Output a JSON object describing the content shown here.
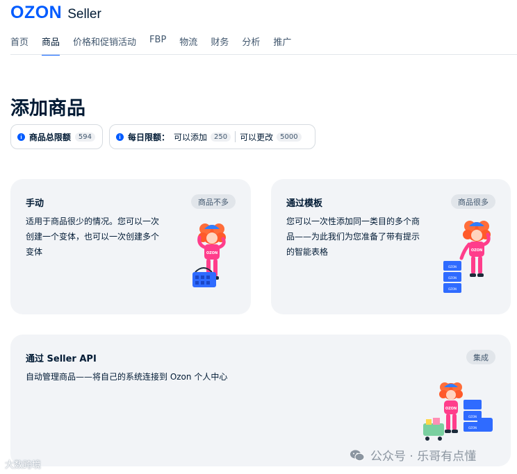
{
  "header": {
    "logo_brand": "OZON",
    "logo_product": "Seller",
    "nav": [
      {
        "label": "首页",
        "active": false
      },
      {
        "label": "商品",
        "active": true
      },
      {
        "label": "价格和促销活动",
        "active": false
      },
      {
        "label": "FBP",
        "active": false
      },
      {
        "label": "物流",
        "active": false
      },
      {
        "label": "财务",
        "active": false
      },
      {
        "label": "分析",
        "active": false
      },
      {
        "label": "推广",
        "active": false
      }
    ]
  },
  "page": {
    "title": "添加商品"
  },
  "limits": {
    "total_label": "商品总限额",
    "total_value": "594",
    "daily_label": "每日限额：",
    "daily_add_text": "可以添加",
    "daily_add_value": "250",
    "daily_edit_text": "可以更改",
    "daily_edit_value": "5000"
  },
  "cards": {
    "manual": {
      "title": "手动",
      "tag": "商品不多",
      "desc_lines": [
        "适用于商品很少的情况。您可以一次",
        "创建一个变体，也可以一次创建多个",
        "变体"
      ]
    },
    "template": {
      "title": "通过模板",
      "tag": "商品很多",
      "desc_lines": [
        "您可以一次性添加同一类目的多个商",
        "品——为此我们为您准备了带有提示",
        "的智能表格"
      ]
    },
    "api": {
      "title": "通过 Seller API",
      "tag": "集成",
      "desc_lines": [
        "自动管理商品——将自己的系统连接到 Ozon 个人中心"
      ]
    }
  },
  "watermarks": {
    "left": "大数跨境",
    "right": "公众号 · 乐哥有点懂"
  },
  "colors": {
    "brand_blue": "#005bff",
    "card_bg": "#f2f4f7",
    "text_primary": "#001a34",
    "mascot_hair": "#ff5a2a",
    "mascot_top": "#ff3d8b"
  }
}
